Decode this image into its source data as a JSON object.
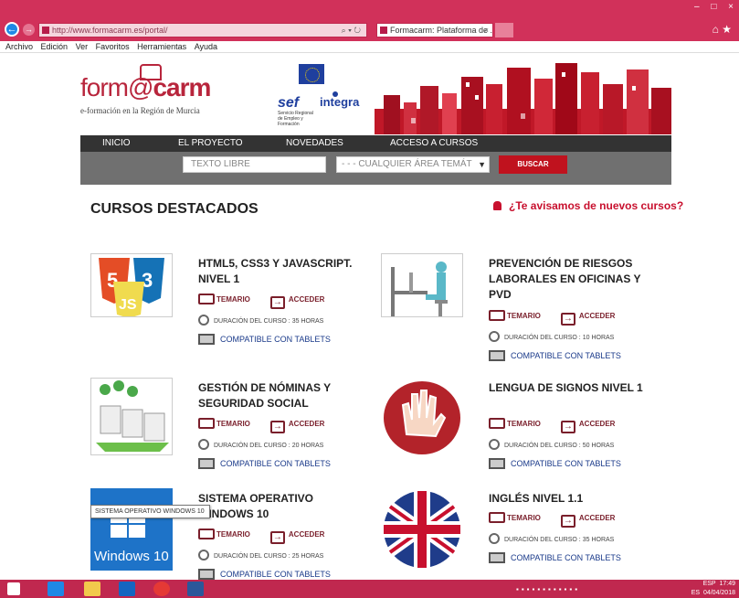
{
  "browser": {
    "url": "http://www.formacarm.es/portal/",
    "tab_title": "Formacarm: Plataforma de ...",
    "menu": [
      "Archivo",
      "Edición",
      "Ver",
      "Favoritos",
      "Herramientas",
      "Ayuda"
    ],
    "window_controls": [
      "–",
      "□",
      "×"
    ]
  },
  "brand": {
    "logo_light": "form@",
    "logo_bold": "carm",
    "tagline": "e-formación en la Región de Murcia",
    "sef": "sef",
    "sef_sub": "Servicio Regional de Empleo y Formación",
    "integra": "integra"
  },
  "nav": {
    "items": [
      "INICIO",
      "EL PROYECTO",
      "NOVEDADES",
      "ACCESO A CURSOS"
    ]
  },
  "search": {
    "placeholder": "TEXTO LIBRE",
    "area_selected": "- - - CUALQUIER ÁREA TEMÁT",
    "button": "BUSCAR"
  },
  "featured": {
    "title": "CURSOS DESTACADOS",
    "notify": "¿Te avisamos de nuevos cursos?"
  },
  "course_labels": {
    "temario": "TEMARIO",
    "acceder": "ACCEDER",
    "duracion": "DURACIÓN DEL CURSO :",
    "tablets": "COMPATIBLE CON TABLETS"
  },
  "courses": [
    {
      "title": "HTML5, CSS3 Y JAVASCRIPT. NIVEL 1",
      "hours": "35 HORAS"
    },
    {
      "title": "PREVENCIÓN DE RIESGOS LABORALES EN OFICINAS Y PVD",
      "hours": "10 HORAS"
    },
    {
      "title": "GESTIÓN DE NÓMINAS Y SEGURIDAD SOCIAL",
      "hours": "20 HORAS"
    },
    {
      "title": "LENGUA DE SIGNOS NIVEL 1",
      "hours": "50 HORAS"
    },
    {
      "title": "SISTEMA OPERATIVO WINDOWS 10",
      "hours": "25 HORAS"
    },
    {
      "title": "INGLÉS NIVEL 1.1",
      "hours": "35 HORAS"
    }
  ],
  "thumb_texts": {
    "windows": "Windows 10"
  },
  "tooltip": "SISTEMA OPERATIVO WINDOWS 10",
  "tray": {
    "lang": "ESP",
    "lang2": "ES",
    "time": "17:49",
    "date": "04/04/2018"
  },
  "colors": {
    "chrome": "#d1315a",
    "accent_red": "#c0121e",
    "nav_dark": "#333333",
    "search_gray": "#707070",
    "course_link": "#7a1f2b",
    "tablet_link": "#1a3a8a"
  }
}
